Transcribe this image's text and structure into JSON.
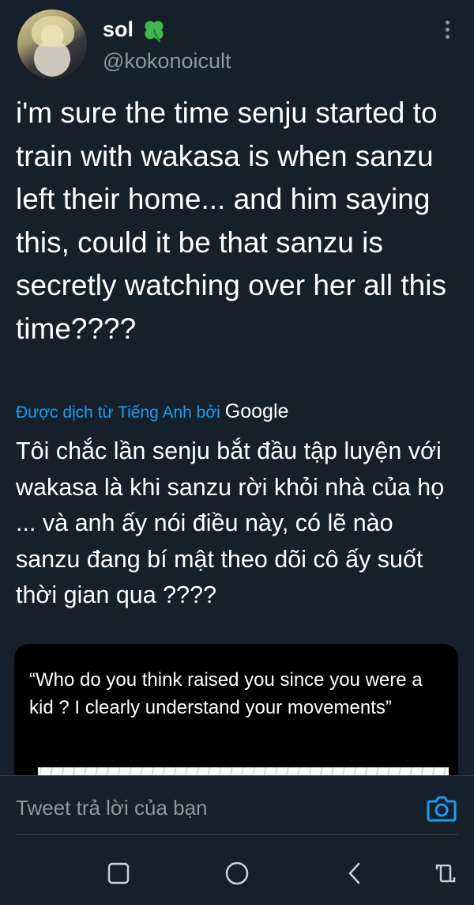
{
  "tweet": {
    "display_name": "sol",
    "handle": "@kokonoicult",
    "text": "i'm sure the time senju started to train with wakasa is when sanzu left their home... and him saying this, could it be that sanzu is secretly watching over her all this time????",
    "translated_by_label": "Được dịch từ Tiếng Anh bởi",
    "translator_brand": "Google",
    "translated_text": "Tôi chắc lần senju bắt đầu tập luyện với wakasa là khi sanzu rời khỏi nhà của họ ... và anh ấy nói điều này, có lẽ nào sanzu đang bí mật theo dõi cô ấy suốt thời gian qua ????"
  },
  "quoted_card": {
    "text": "“Who do you think raised you since you were a kid ? I clearly understand your movements”"
  },
  "reply": {
    "placeholder": "Tweet trả lời của bạn"
  },
  "icons": {
    "emoji": "four-leaf-clover-icon",
    "more": "more-vertical-icon",
    "camera": "camera-icon",
    "nav": [
      "recent-apps-icon",
      "home-icon",
      "back-icon",
      "rotate-icon"
    ]
  },
  "colors": {
    "background": "#15202b",
    "text": "#ffffff",
    "secondary": "#8b98a5",
    "accent": "#1d9bf0",
    "card": "#000000"
  }
}
